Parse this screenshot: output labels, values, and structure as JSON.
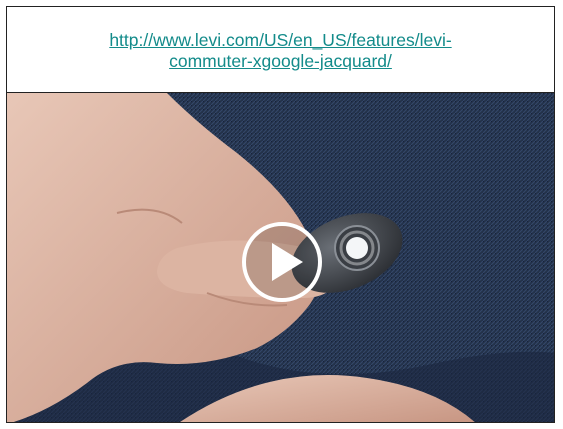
{
  "link": {
    "line1": "http://www.levi.com/US/en_US/features/levi-",
    "line2": "commuter-xgoogle-jacquard/"
  },
  "video": {
    "play_icon": "play-icon",
    "subject": "hand-holding-snap-tag-on-denim-cuff"
  },
  "colors": {
    "link": "#138b8a",
    "denim": "#1f2e45",
    "skin": "#d9b3a1"
  }
}
